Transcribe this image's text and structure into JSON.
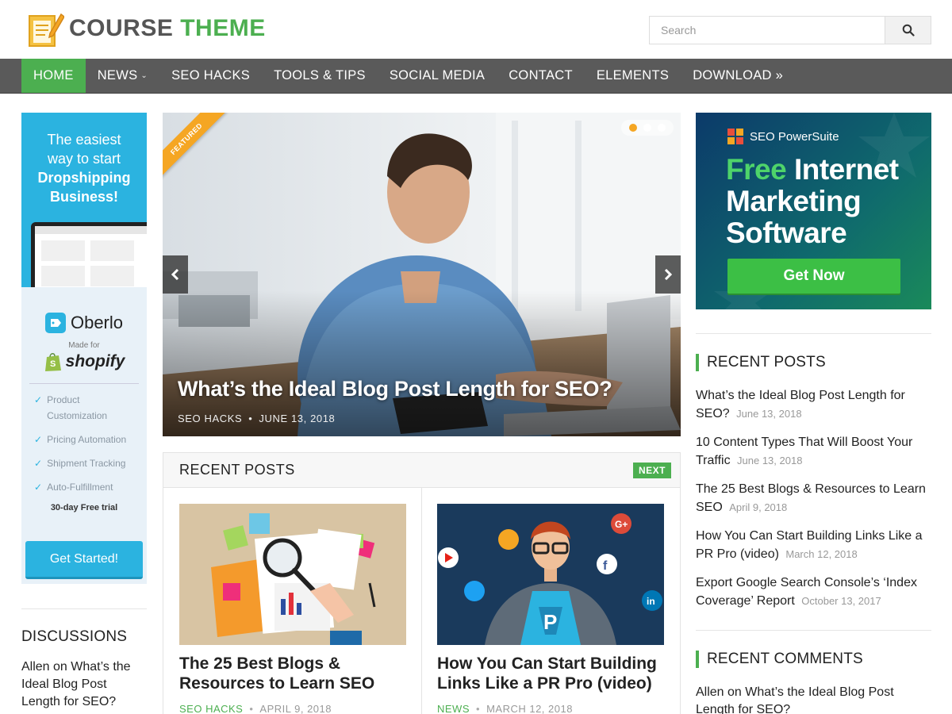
{
  "logo": {
    "word1": "COURSE",
    "word2": "THEME"
  },
  "search": {
    "placeholder": "Search"
  },
  "nav": {
    "items": [
      {
        "label": "HOME"
      },
      {
        "label": "NEWS",
        "caret": "⌄"
      },
      {
        "label": "SEO HACKS"
      },
      {
        "label": "TOOLS & TIPS"
      },
      {
        "label": "SOCIAL MEDIA"
      },
      {
        "label": "CONTACT"
      },
      {
        "label": "ELEMENTS"
      },
      {
        "label": "DOWNLOAD »"
      }
    ]
  },
  "left_ad": {
    "line1": "The easiest",
    "line2": "way to start",
    "line3": "Dropshipping",
    "line4": "Business!",
    "brand": "Oberlo",
    "made_for": "Made for",
    "shopify": "shopify",
    "features": [
      "Product Customization",
      "Pricing Automation",
      "Shipment Tracking",
      "Auto-Fulfillment"
    ],
    "trial": "30-day Free trial",
    "cta": "Get Started!"
  },
  "discussions": {
    "title": "DISCUSSIONS",
    "text": "Allen on What’s the Ideal Blog Post Length for SEO?"
  },
  "slider": {
    "ribbon": "FEATURED",
    "title": "What’s the Ideal Blog Post Length for SEO?",
    "category": "SEO HACKS",
    "date": "JUNE 13, 2018",
    "prev": "‹",
    "next": "›"
  },
  "recent_block": {
    "title": "RECENT POSTS",
    "next": "NEXT",
    "cards": [
      {
        "title": "The 25 Best Blogs & Resources to Learn SEO",
        "category": "SEO HACKS",
        "date": "APRIL 9, 2018"
      },
      {
        "title": "How You Can Start Building Links Like a PR Pro (video)",
        "category": "NEWS",
        "date": "MARCH 12, 2018"
      }
    ]
  },
  "right_ad": {
    "brand": "SEO PowerSuite",
    "free": "Free",
    "line1": "Internet",
    "line2": "Marketing",
    "line3": "Software",
    "cta": "Get Now"
  },
  "sidebar_recent": {
    "title": "RECENT POSTS",
    "posts": [
      {
        "title": "What’s the Ideal Blog Post Length for SEO?",
        "date": "June 13, 2018"
      },
      {
        "title": "10 Content Types That Will Boost Your Traffic",
        "date": "June 13, 2018"
      },
      {
        "title": "The 25 Best Blogs & Resources to Learn SEO",
        "date": "April 9, 2018"
      },
      {
        "title": "How You Can Start Building Links Like a PR Pro (video)",
        "date": "March 12, 2018"
      },
      {
        "title": "Export Google Search Console’s ‘Index Coverage’ Report",
        "date": "October 13, 2017"
      }
    ]
  },
  "sidebar_comments": {
    "title": "RECENT COMMENTS",
    "text": "Allen on What’s the Ideal Blog Post Length for SEO?"
  },
  "colors": {
    "accent": "#4caf50",
    "nav_bg": "#5a5a5a",
    "ribbon": "#f5a623",
    "oberlo": "#2bb3e0"
  }
}
